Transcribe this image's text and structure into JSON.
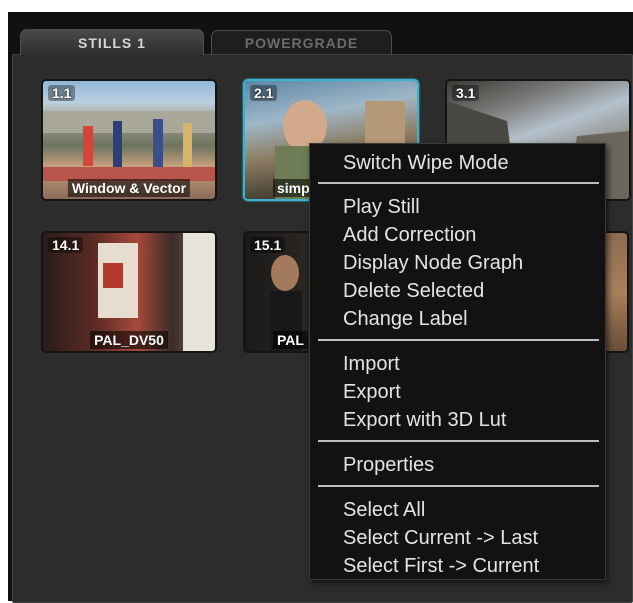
{
  "tabs": [
    {
      "label": "STILLS 1",
      "active": true
    },
    {
      "label": "POWERGRADE",
      "active": false
    }
  ],
  "stills": [
    {
      "id": "1.1",
      "label": "Window & Vector",
      "selected": false
    },
    {
      "id": "2.1",
      "label": "simp",
      "selected": true
    },
    {
      "id": "3.1",
      "label": "",
      "selected": false
    },
    {
      "id": "14.1",
      "label": "PAL_DV50",
      "selected": false
    },
    {
      "id": "15.1",
      "label": "PAL",
      "selected": false
    }
  ],
  "context_menu": {
    "items": [
      "Switch Wipe Mode",
      "Play Still",
      "Add Correction",
      "Display Node Graph",
      "Delete Selected",
      "Change Label",
      "Import",
      "Export",
      "Export with 3D Lut",
      "Properties",
      "Select All",
      "Select Current -> Last",
      "Select First -> Current"
    ]
  },
  "colors": {
    "selection_border": "#38b6cf",
    "menu_background": "#121212",
    "panel_background": "#2c2c2c"
  }
}
